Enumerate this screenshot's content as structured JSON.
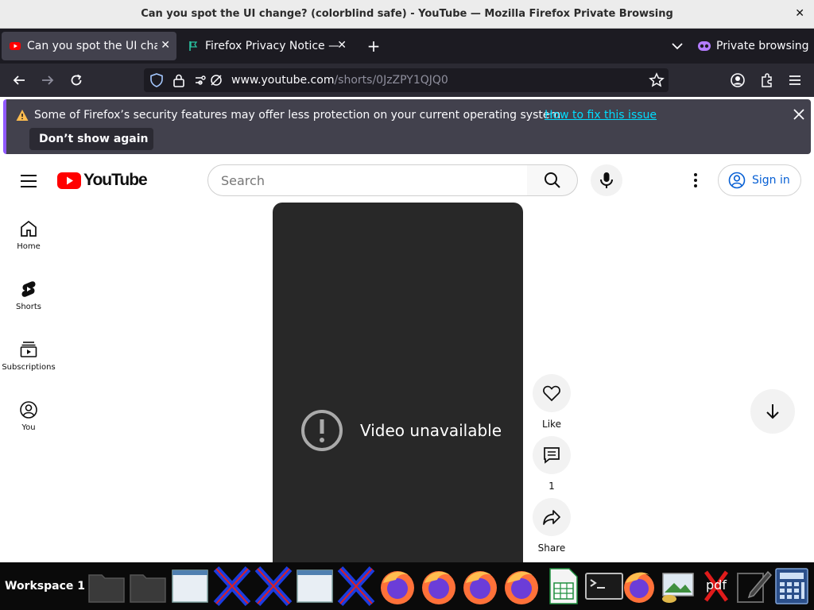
{
  "window": {
    "title": "Can you spot the UI change? (colorblind safe) - YouTube — Mozilla Firefox Private Browsing",
    "close_glyph": "✕"
  },
  "tabs": [
    {
      "label": "Can you spot the UI change? (colorblind safe) - YouTube",
      "active": true,
      "favicon": "youtube-icon"
    },
    {
      "label": "Firefox Privacy Notice — Mozilla",
      "active": false,
      "favicon": "firefox-privacy-icon"
    }
  ],
  "toolbar": {
    "new_tab_glyph": "+",
    "private_label": "Private browsing",
    "url_host": "www.youtube.com",
    "url_path": "/shorts/0JzZPY1QJQ0"
  },
  "notification": {
    "message": "Some of Firefox’s security features may offer less protection on your current operating system.",
    "link": "How to fix this issue",
    "button": "Don’t show again"
  },
  "youtube": {
    "logo_text": "YouTube",
    "search_placeholder": "Search",
    "sign_in": "Sign in",
    "guide": [
      {
        "label": "Home",
        "icon": "home-icon"
      },
      {
        "label": "Shorts",
        "icon": "shorts-icon"
      },
      {
        "label": "Subscriptions",
        "icon": "subscriptions-icon"
      },
      {
        "label": "You",
        "icon": "you-icon"
      }
    ],
    "player_message": "Video unavailable",
    "actions": {
      "like": "Like",
      "comments": "1",
      "share": "Share"
    }
  },
  "taskbar": {
    "workspace": "Workspace 1",
    "pdf_label": "pdf"
  },
  "colors": {
    "youtube_red": "#ff0000",
    "firefox_accent": "#9059ff",
    "link_cyan": "#00ddff",
    "sign_in_blue": "#065fd4"
  }
}
